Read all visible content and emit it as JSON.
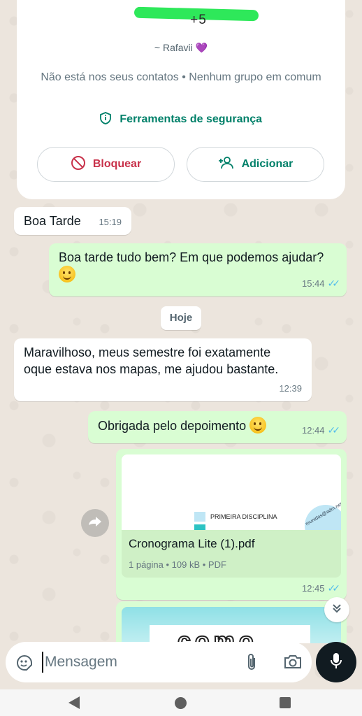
{
  "profile": {
    "phone_redacted": "+5",
    "push_name": "~ Rafavii",
    "push_name_emoji": "💜",
    "not_in_contacts": "Não está nos seus contatos • Nenhum grupo em comum",
    "safety_tools": "Ferramentas de segurança",
    "block_label": "Bloquear",
    "add_label": "Adicionar"
  },
  "messages": [
    {
      "direction": "in",
      "text": "Boa Tarde",
      "time": "15:19"
    },
    {
      "direction": "out",
      "text": "Boa tarde tudo bem? Em que podemos ajudar?",
      "time": "15:44",
      "status": "read"
    },
    {
      "direction": "in",
      "text": "Maravilhoso, meus semestre foi exatamente oque estava nos mapas, me ajudou bastante.",
      "time": "12:39"
    },
    {
      "direction": "out",
      "text": "Obrigada pelo depoimento",
      "time": "12:44",
      "status": "read"
    }
  ],
  "day_separator": "Hoje",
  "document": {
    "preview_label": "PRIMEIRA DISCIPLINA",
    "preview_stamp": "reunidas@adm.net",
    "file_name": "Cronograma Lite (1).pdf",
    "meta": "1 página • 109 kB • PDF",
    "time": "12:45",
    "status": "read"
  },
  "next_image_text": "como",
  "input": {
    "placeholder": "Mensagem"
  },
  "icons": {
    "shield": "shield-icon",
    "block": "block-icon",
    "add_person": "add-person-icon",
    "forward": "forward-icon",
    "scroll_down": "double-chevron-down-icon",
    "sticker": "sticker-icon",
    "attach": "paperclip-icon",
    "camera": "camera-icon",
    "mic": "mic-icon"
  },
  "colors": {
    "accent": "#008069",
    "block_red": "#c8314a",
    "outgoing_bubble": "#d9fdd3",
    "read_ticks": "#53bdeb"
  }
}
